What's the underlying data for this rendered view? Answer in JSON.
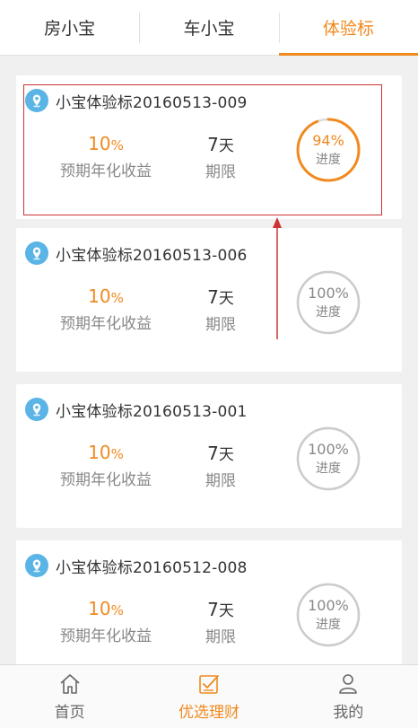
{
  "tabs": [
    {
      "label": "房小宝",
      "active": false
    },
    {
      "label": "车小宝",
      "active": false
    },
    {
      "label": "体验标",
      "active": true
    }
  ],
  "products": [
    {
      "name": "小宝体验标20160513-009",
      "rate": "10",
      "rate_unit": "%",
      "rate_label": "预期年化收益",
      "term": "7",
      "term_unit": "天",
      "term_label": "期限",
      "progress_value": 94,
      "progress_text": "94%",
      "progress_label": "进度"
    },
    {
      "name": "小宝体验标20160513-006",
      "rate": "10",
      "rate_unit": "%",
      "rate_label": "预期年化收益",
      "term": "7",
      "term_unit": "天",
      "term_label": "期限",
      "progress_value": 100,
      "progress_text": "100%",
      "progress_label": "进度"
    },
    {
      "name": "小宝体验标20160513-001",
      "rate": "10",
      "rate_unit": "%",
      "rate_label": "预期年化收益",
      "term": "7",
      "term_unit": "天",
      "term_label": "期限",
      "progress_value": 100,
      "progress_text": "100%",
      "progress_label": "进度"
    },
    {
      "name": "小宝体验标20160512-008",
      "rate": "10",
      "rate_unit": "%",
      "rate_label": "预期年化收益",
      "term": "7",
      "term_unit": "天",
      "term_label": "期限",
      "progress_value": 100,
      "progress_text": "100%",
      "progress_label": "进度"
    }
  ],
  "nav": [
    {
      "label": "首页",
      "icon": "home-icon",
      "active": false
    },
    {
      "label": "优选理财",
      "icon": "checklist-icon",
      "active": true
    },
    {
      "label": "我的",
      "icon": "user-icon",
      "active": false
    }
  ],
  "colors": {
    "accent": "#f08a1f",
    "pin": "#5ab4e6",
    "ring_idle": "#cccccc",
    "annotation": "#cc3333"
  }
}
